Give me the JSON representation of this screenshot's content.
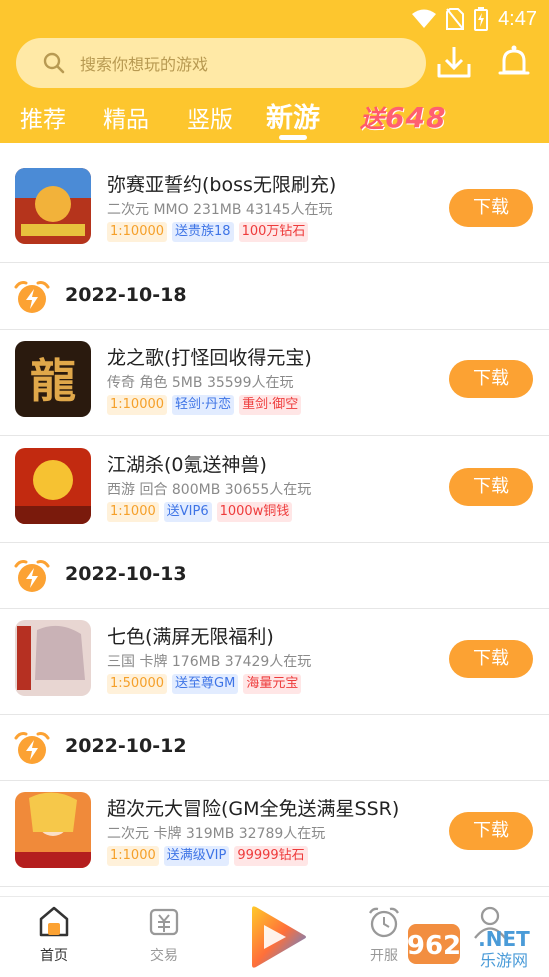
{
  "status": {
    "time": "4:47"
  },
  "search": {
    "placeholder": "搜索你想玩的游戏"
  },
  "tabs": [
    {
      "label": "推荐"
    },
    {
      "label": "精品"
    },
    {
      "label": "竖版"
    },
    {
      "label": "新游"
    }
  ],
  "promo": {
    "prefix": "送",
    "amount": "648"
  },
  "games": [
    {
      "title": "弥赛亚誓约(boss无限刷充)",
      "meta": "二次元 MMO 231MB 43145人在玩",
      "tags": [
        "1:10000",
        "送贵族18",
        "100万钻石"
      ],
      "download": "下载"
    },
    {
      "title": "龙之歌(打怪回收得元宝)",
      "meta": "传奇 角色 5MB 35599人在玩",
      "tags": [
        "1:10000",
        "轻剑·丹恋",
        "重剑·御空"
      ],
      "download": "下载"
    },
    {
      "title": "江湖杀(0氪送神兽)",
      "meta": "西游 回合 800MB 30655人在玩",
      "tags": [
        "1:1000",
        "送VIP6",
        "1000w铜钱"
      ],
      "download": "下载"
    },
    {
      "title": "七色(满屏无限福利)",
      "meta": "三国 卡牌 176MB 37429人在玩",
      "tags": [
        "1:50000",
        "送至尊GM",
        "海量元宝"
      ],
      "download": "下载"
    },
    {
      "title": "超次元大冒险(GM全免送满星SSR)",
      "meta": "二次元 卡牌 319MB 32789人在玩",
      "tags": [
        "1:1000",
        "送满级VIP",
        "99999钻石"
      ],
      "download": "下载"
    }
  ],
  "dates": [
    "2022-10-18",
    "2022-10-13",
    "2022-10-12"
  ],
  "bottom_nav": [
    {
      "label": "首页"
    },
    {
      "label": "交易"
    },
    {
      "label": "开服"
    }
  ],
  "colors": {
    "accent": "#fdc62e",
    "download": "#fca233"
  }
}
